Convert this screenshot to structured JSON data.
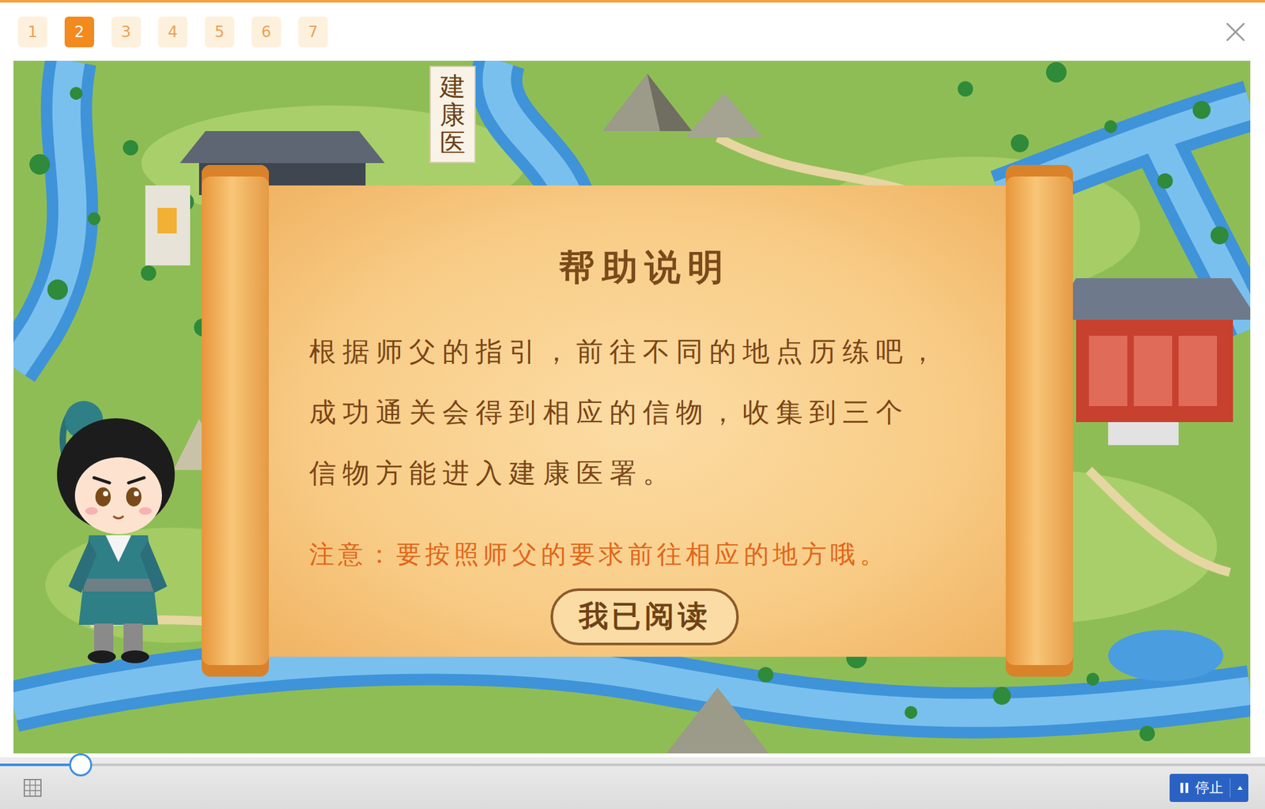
{
  "pages": [
    {
      "label": "1",
      "selected": false
    },
    {
      "label": "2",
      "selected": true
    },
    {
      "label": "3",
      "selected": false
    },
    {
      "label": "4",
      "selected": false
    },
    {
      "label": "5",
      "selected": false
    },
    {
      "label": "6",
      "selected": false
    },
    {
      "label": "7",
      "selected": false
    }
  ],
  "map": {
    "sign": "建康医"
  },
  "dialog": {
    "title": "帮助说明",
    "body_lines": [
      "根据师父的指引，前往不同的地点历练吧，",
      "成功通关会得到相应的信物，收集到三个",
      "信物方能进入建康医署。"
    ],
    "note": "注意：要按照师父的要求前往相应的地方哦。",
    "button": "我已阅读"
  },
  "player": {
    "progress": {
      "level": 0.064
    },
    "stop_button": {
      "label": "停止"
    }
  }
}
